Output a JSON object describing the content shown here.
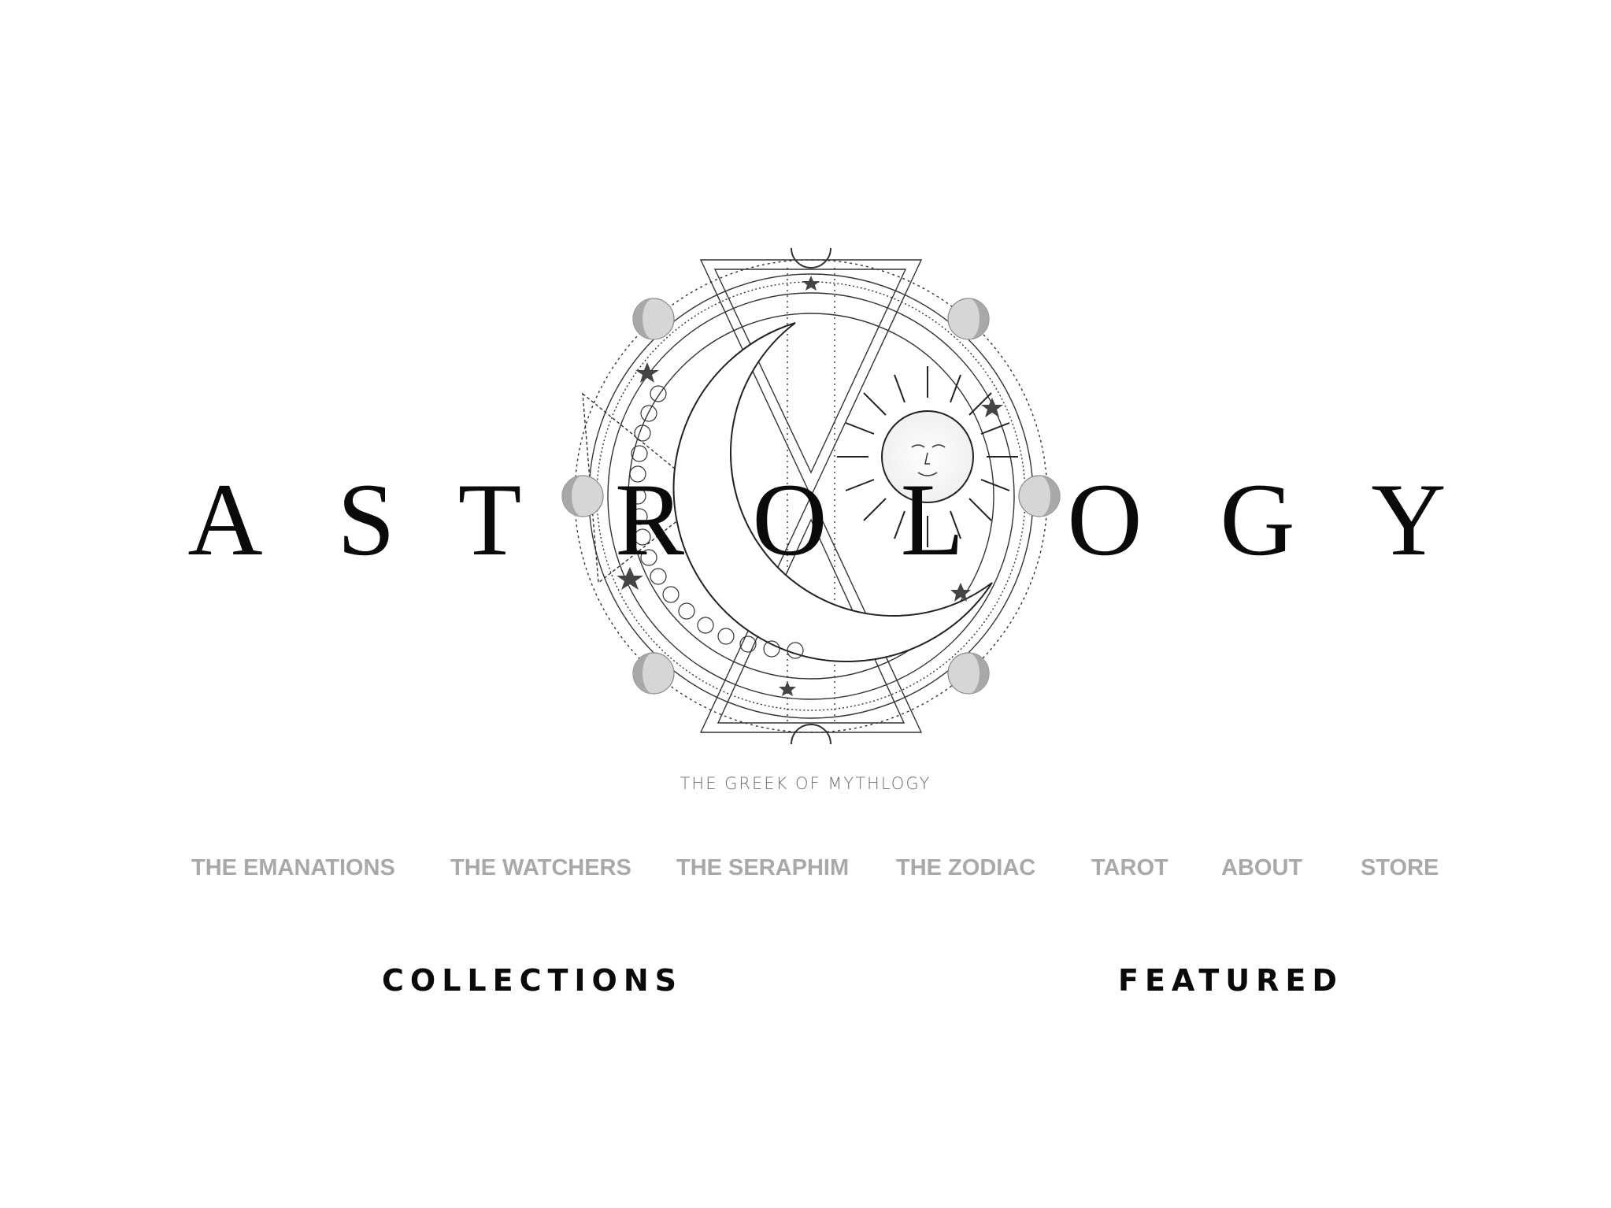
{
  "brand": {
    "letters": [
      "A",
      "S",
      "T",
      "R",
      "O",
      "L",
      "O",
      "G",
      "Y"
    ],
    "emblem_icon": "celestial-moon-sun-emblem"
  },
  "tagline": "THE GREEK OF MYTHLOGY",
  "nav": {
    "items": [
      {
        "label": "THE EMANATIONS"
      },
      {
        "label": "THE WATCHERS"
      },
      {
        "label": "THE SERAPHIM"
      },
      {
        "label": "THE ZODIAC"
      },
      {
        "label": "TAROT"
      },
      {
        "label": "ABOUT"
      },
      {
        "label": "STORE"
      }
    ]
  },
  "sections": {
    "collections": "COLLECTIONS",
    "featured": "FEATURED"
  },
  "colors": {
    "nav_text": "#a9a9a9",
    "tagline_text": "#7a6c5f",
    "heading_text": "#0a0a0a",
    "emblem_line": "#333333",
    "moon_fill": "#d6d6d6"
  }
}
